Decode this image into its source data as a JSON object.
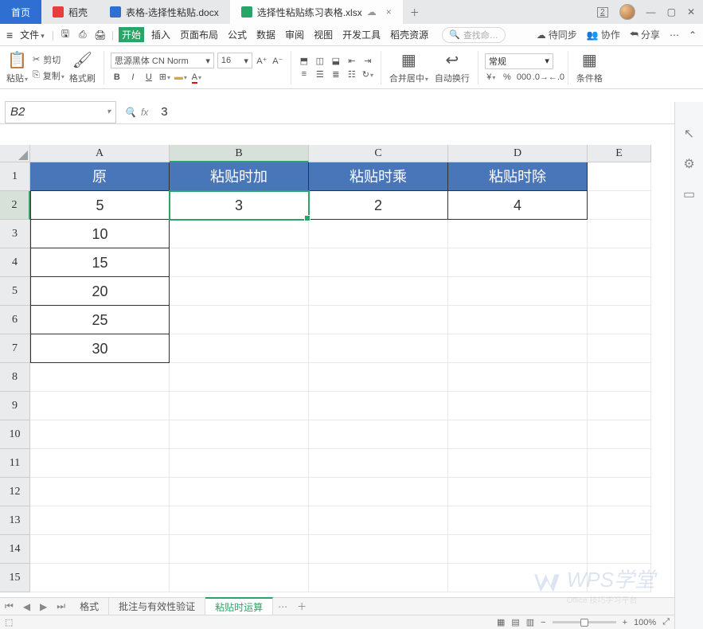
{
  "tabs": {
    "home": "首页",
    "docker": "稻壳",
    "word": "表格-选择性粘贴.docx",
    "sheet": "选择性粘贴练习表格.xlsx",
    "box_num": "2"
  },
  "menu": {
    "file": "文件",
    "start": "开始",
    "insert": "插入",
    "layout": "页面布局",
    "formula": "公式",
    "data": "数据",
    "review": "审阅",
    "view": "视图",
    "dev": "开发工具",
    "res": "稻壳资源",
    "search_ph": "查找命…",
    "sync": "待同步",
    "coop": "协作",
    "share": "分享"
  },
  "ribbon": {
    "paste": "粘贴",
    "cut": "剪切",
    "copy": "复制",
    "painter": "格式刷",
    "font_name": "思源黑体 CN Norm",
    "font_size": "16",
    "merge": "合并居中",
    "wrap": "自动换行",
    "num_format": "常规",
    "cond": "条件格"
  },
  "name_box": "B2",
  "fx_value": "3",
  "columns": [
    "A",
    "B",
    "C",
    "D",
    "E"
  ],
  "row_nums": [
    "1",
    "2",
    "3",
    "4",
    "5",
    "6",
    "7",
    "8",
    "9",
    "10",
    "11",
    "12",
    "13",
    "14",
    "15"
  ],
  "headers": {
    "A": "原",
    "B": "粘贴时加",
    "C": "粘贴时乘",
    "D": "粘贴时除"
  },
  "data_row2": {
    "A": "5",
    "B": "3",
    "C": "2",
    "D": "4"
  },
  "colA_rest": {
    "r3": "10",
    "r4": "15",
    "r5": "20",
    "r6": "25",
    "r7": "30"
  },
  "sheets": {
    "s1": "格式",
    "s2": "批注与有效性验证",
    "s3": "粘贴时运算"
  },
  "status": {
    "zoom": "100%"
  },
  "watermark": {
    "brand": "WPS学堂",
    "sub": "Office 技巧学习平台"
  }
}
